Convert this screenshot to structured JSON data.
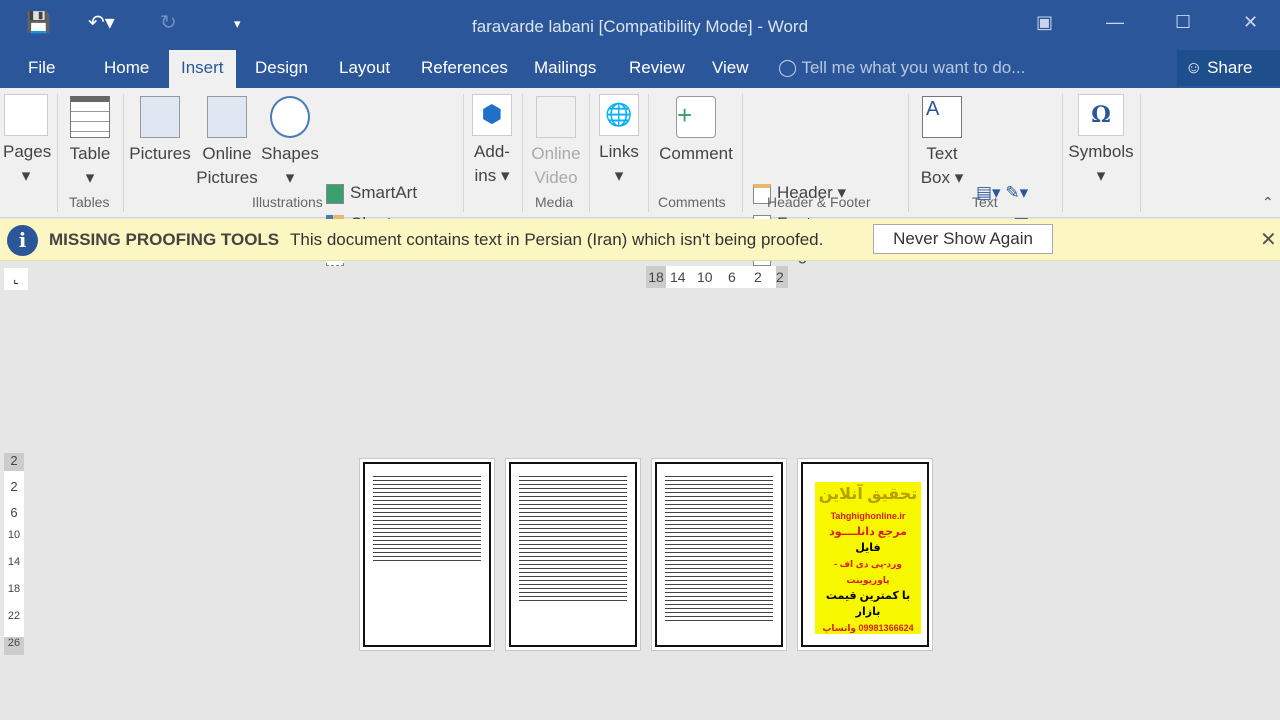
{
  "window": {
    "title": "faravarde labani [Compatibility Mode] - Word"
  },
  "tabs": [
    {
      "label": "File"
    },
    {
      "label": "Home"
    },
    {
      "label": "Insert"
    },
    {
      "label": "Design"
    },
    {
      "label": "Layout"
    },
    {
      "label": "References"
    },
    {
      "label": "Mailings"
    },
    {
      "label": "Review"
    },
    {
      "label": "View"
    }
  ],
  "tell_me": "Tell me what you want to do...",
  "share": "Share",
  "ribbon": {
    "pages": "Pages",
    "table": "Table",
    "pictures": "Pictures",
    "online_pictures": "Online Pictures",
    "shapes": "Shapes",
    "smartart": "SmartArt",
    "chart": "Chart",
    "screenshot": "Screenshot",
    "addins": "Add-ins",
    "online_video": "Online Video",
    "links": "Links",
    "comment": "Comment",
    "header": "Header",
    "footer": "Footer",
    "page_number": "Page Number",
    "text_box": "Text Box",
    "symbols": "Symbols",
    "groups": {
      "tables": "Tables",
      "illustrations": "Illustrations",
      "media": "Media",
      "comments": "Comments",
      "header_footer": "Header & Footer",
      "text": "Text"
    }
  },
  "message": {
    "title": "MISSING PROOFING TOOLS",
    "text": "This document contains text in Persian (Iran) which isn't being proofed.",
    "button": "Never Show Again"
  },
  "ruler": {
    "horizontal": [
      "18",
      "14",
      "10",
      "6",
      "2",
      "2"
    ],
    "vertical": [
      "2",
      "2",
      "6",
      "10",
      "14",
      "18",
      "22",
      "26"
    ]
  },
  "ad": {
    "l1": "تحقیق آنلاین",
    "l2": "Tahghighonline.ir",
    "l3": "مرجع دانلــــود",
    "l4": "فایل",
    "l5": "ورد-پی دی اف - پاورپوینت",
    "l6": "با کمترین قیمت بازار",
    "l7": "09981366624 واتساپ"
  },
  "colors": {
    "brand": "#2b579a",
    "message_bar": "#fcf7c2"
  }
}
